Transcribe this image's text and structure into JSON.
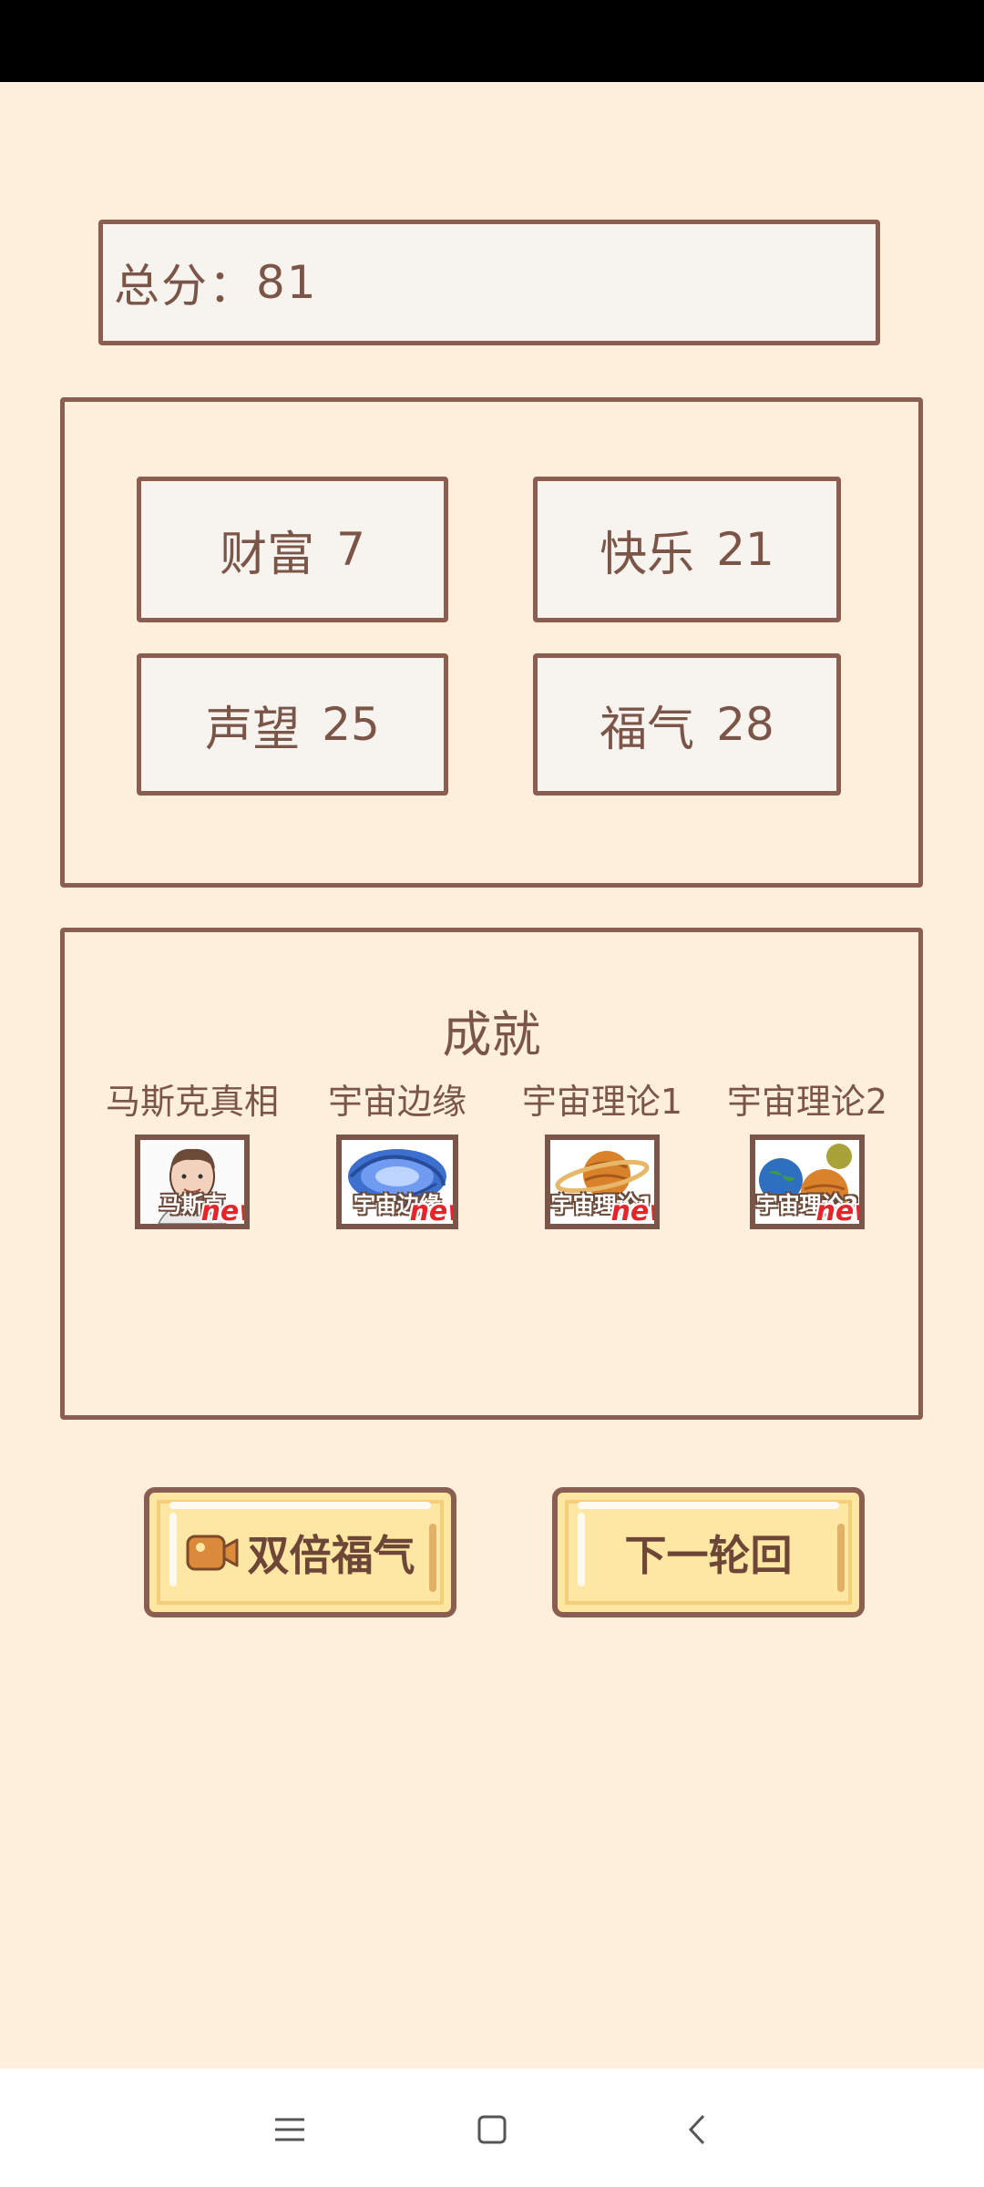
{
  "score": {
    "label": "总分：",
    "value": "81"
  },
  "stats": [
    {
      "name": "财富",
      "value": "7"
    },
    {
      "name": "快乐",
      "value": "21"
    },
    {
      "name": "声望",
      "value": "25"
    },
    {
      "name": "福气",
      "value": "28"
    }
  ],
  "achievements": {
    "title": "成就",
    "items": [
      {
        "label": "马斯克真相",
        "caption": "马斯克",
        "badge": "new",
        "icon": "portrait-icon"
      },
      {
        "label": "宇宙边缘",
        "caption": "宇宙边缘",
        "badge": "new",
        "icon": "galaxy-icon"
      },
      {
        "label": "宇宙理论1",
        "caption": "宇宙理论1",
        "badge": "new",
        "icon": "planet-icon"
      },
      {
        "label": "宇宙理论2",
        "caption": "宇宙理论2",
        "badge": "new",
        "icon": "planets-icon"
      }
    ]
  },
  "buttons": {
    "double_label": "双倍福气",
    "double_icon": "video-camera-icon",
    "next_label": "下一轮回"
  },
  "nav": {
    "menu_icon": "menu-icon",
    "home_icon": "home-square-icon",
    "back_icon": "back-chevron-icon"
  },
  "colors": {
    "background": "#fdefdc",
    "border": "#8b5e52",
    "text": "#7a5548",
    "button": "#fde7a3",
    "badge": "#e8242b"
  }
}
